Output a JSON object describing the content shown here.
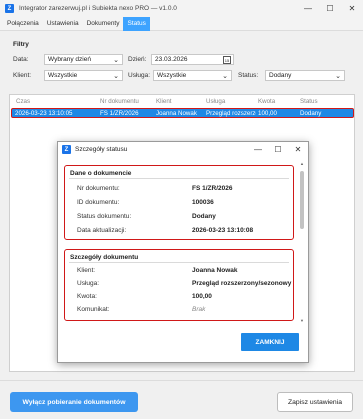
{
  "window": {
    "icon": "Z",
    "title": "Integrator zarezerwuj.pl i Subiekta nexo PRO — v1.0.0",
    "controls": {
      "minimize": "—",
      "maximize": "☐",
      "close": "✕"
    }
  },
  "menu": {
    "items": [
      "Połączenia",
      "Ustawienia",
      "Dokumenty",
      "Status"
    ],
    "active": "Status"
  },
  "filters": {
    "header": "Filtry",
    "data_label": "Data:",
    "data_value": "Wybrany dzień",
    "dzien_label": "Dzień:",
    "dzien_value": "23.03.2026",
    "calendar_glyph": "15",
    "klient_label": "Klient:",
    "klient_value": "Wszystkie",
    "usluga_label": "Usługa:",
    "usluga_value": "Wszystkie",
    "status_label": "Status:",
    "status_value": "Dodany"
  },
  "grid": {
    "columns": [
      "Czas",
      "Nr dokumentu",
      "Klient",
      "Usługa",
      "Kwota",
      "Status"
    ],
    "rows": [
      {
        "czas": "2026-03-23 13:10:05",
        "nr": "FS 1/ZR/2026",
        "klient": "Joanna Nowak",
        "usluga": "Przegląd rozszerzo",
        "kwota": "100,00",
        "status": "Dodany"
      }
    ]
  },
  "dialog": {
    "icon": "Z",
    "title": "Szczegóły statusu",
    "controls": {
      "minimize": "—",
      "maximize": "☐",
      "close": "✕"
    },
    "section1": {
      "title": "Dane o dokumencie",
      "fields": [
        {
          "label": "Nr dokumentu:",
          "value": "FS 1/ZR/2026"
        },
        {
          "label": "ID dokumentu:",
          "value": "100036"
        },
        {
          "label": "Status dokumentu:",
          "value": "Dodany"
        },
        {
          "label": "Data aktualizacji:",
          "value": "2026-03-23 13:10:08"
        }
      ]
    },
    "section2": {
      "title": "Szczegóły dokumentu",
      "fields": [
        {
          "label": "Klient:",
          "value": "Joanna Nowak"
        },
        {
          "label": "Usługa:",
          "value": "Przegląd rozszerzony/sezonowy"
        },
        {
          "label": "Kwota:",
          "value": "100,00"
        },
        {
          "label": "Komunikat:",
          "value": "Brak"
        }
      ]
    },
    "close_button": "ZAMKNIJ"
  },
  "bottom": {
    "stop_button": "Wyłącz pobieranie dokumentów",
    "save_button": "Zapisz ustawienia"
  },
  "colors": {
    "accent": "#1e88e5",
    "highlight_border": "#d01818"
  }
}
